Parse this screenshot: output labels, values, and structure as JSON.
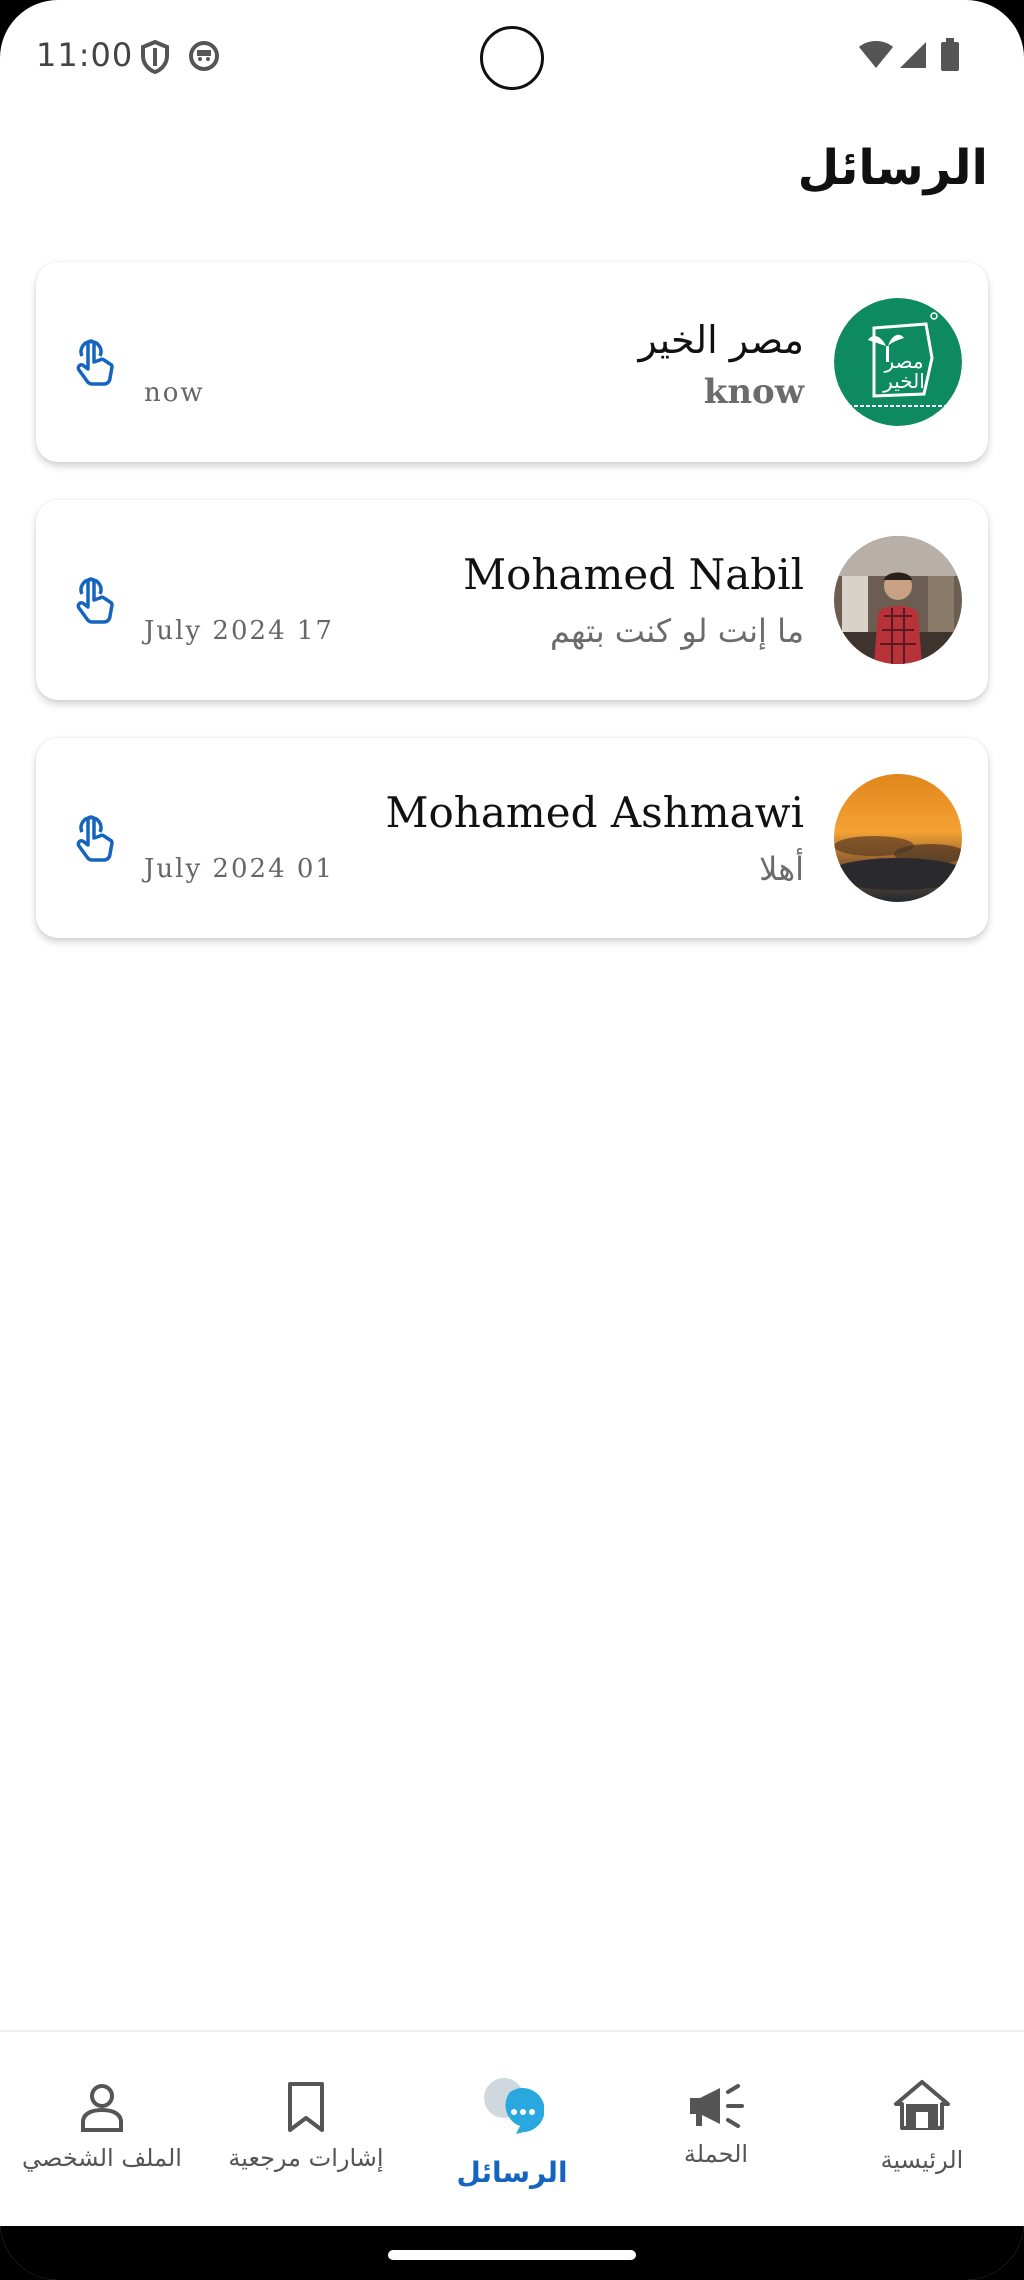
{
  "status_bar": {
    "time": "11:00"
  },
  "header": {
    "title": "الرسائل"
  },
  "conversations": [
    {
      "name": "مصر الخير",
      "message": "know",
      "time": "now"
    },
    {
      "name": "Mohamed Nabil",
      "message": "ما إنت لو كنت بتهم",
      "time": "July 2024 17"
    },
    {
      "name": "Mohamed Ashmawi",
      "message": "أهلا",
      "time": "July 2024 01"
    }
  ],
  "bottom_nav": {
    "items": [
      {
        "label": "الملف الشخصي",
        "icon": "person-icon"
      },
      {
        "label": "إشارات مرجعية",
        "icon": "bookmark-icon"
      },
      {
        "label": "الرسائل",
        "icon": "chat-icon",
        "active": true
      },
      {
        "label": "الحملة",
        "icon": "megaphone-icon"
      },
      {
        "label": "الرئيسية",
        "icon": "home-icon"
      }
    ]
  },
  "colors": {
    "accent": "#1565c0",
    "logo_green": "#0d8a5f"
  }
}
